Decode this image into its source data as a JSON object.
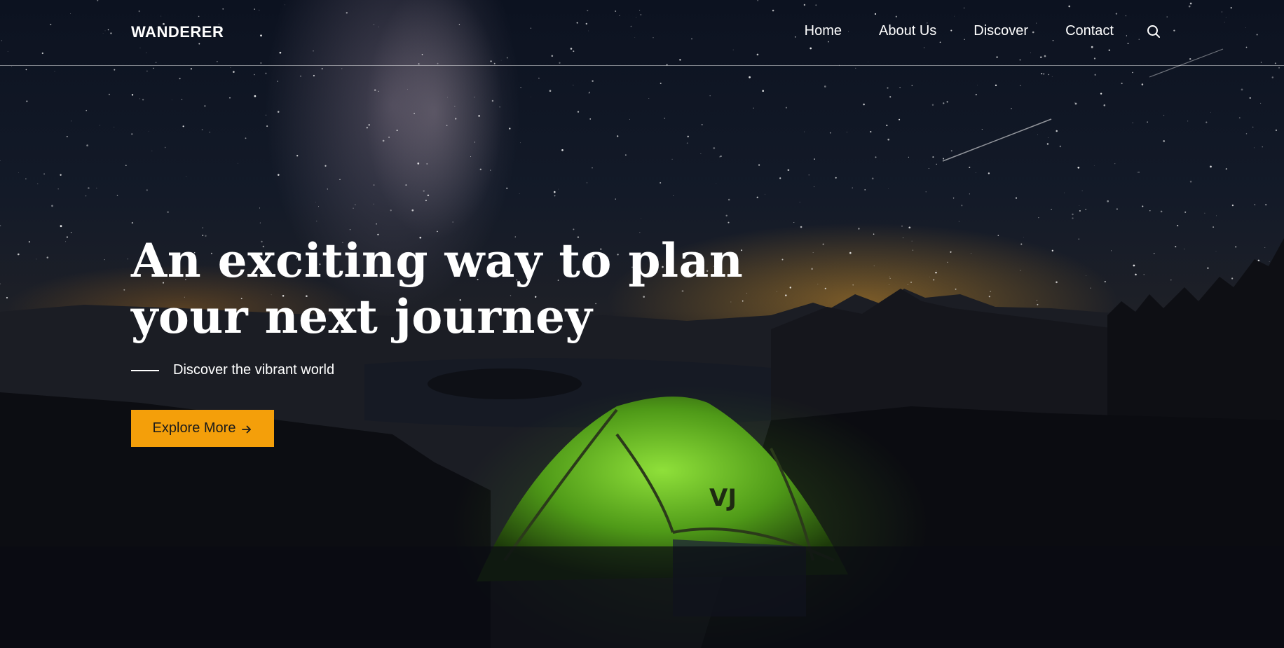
{
  "header": {
    "logo": "WANDERER",
    "nav": [
      "Home",
      "About Us",
      "Discover",
      "Contact"
    ],
    "search_icon": "search-icon"
  },
  "hero": {
    "title_line1": "An exciting way to plan",
    "title_line2": "your next journey",
    "subtitle": "Discover the vibrant world",
    "cta_label": "Explore More",
    "cta_icon": "arrow-right-icon",
    "background": "night sky with milky way, mountains and green tent"
  },
  "colors": {
    "accent": "#f49f0a",
    "text": "#ffffff",
    "background": "#0a0b12"
  }
}
